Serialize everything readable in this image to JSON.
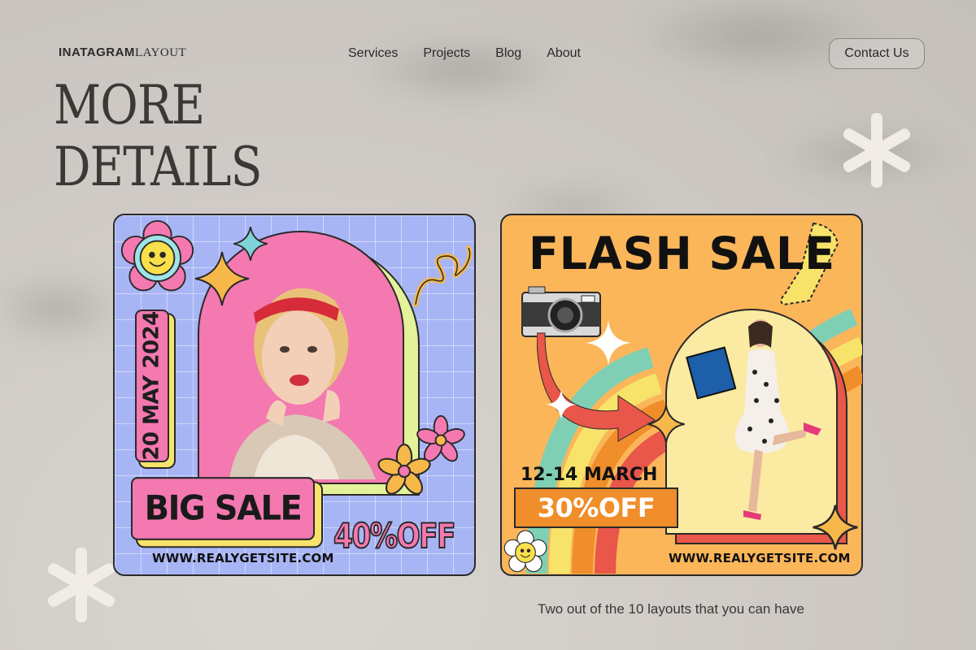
{
  "header": {
    "brand_bold": "INATAGRAM",
    "brand_thin": "LAYOUT",
    "nav": [
      "Services",
      "Projects",
      "Blog",
      "About"
    ],
    "contact_label": "Contact Us"
  },
  "hero": {
    "line1": "MORE",
    "line2": "DETAILS"
  },
  "card1": {
    "date": "20 MAY 2024",
    "headline": "BIG SALE",
    "discount": "40%OFF",
    "url": "WWW.REALYGETSITE.COM"
  },
  "card2": {
    "headline": "FLASH SALE",
    "dates": "12-14 MARCH",
    "discount": "30%OFF",
    "url": "WWW.REALYGETSITE.COM"
  },
  "caption": "Two out of the 10 layouts that you can have",
  "colors": {
    "background": "#cdc8c3",
    "card1_bg": "#a8b5f5",
    "card2_bg": "#fbb65a",
    "pink": "#f479b0",
    "yellow": "#f7e36a",
    "orange": "#ef8e2a"
  }
}
